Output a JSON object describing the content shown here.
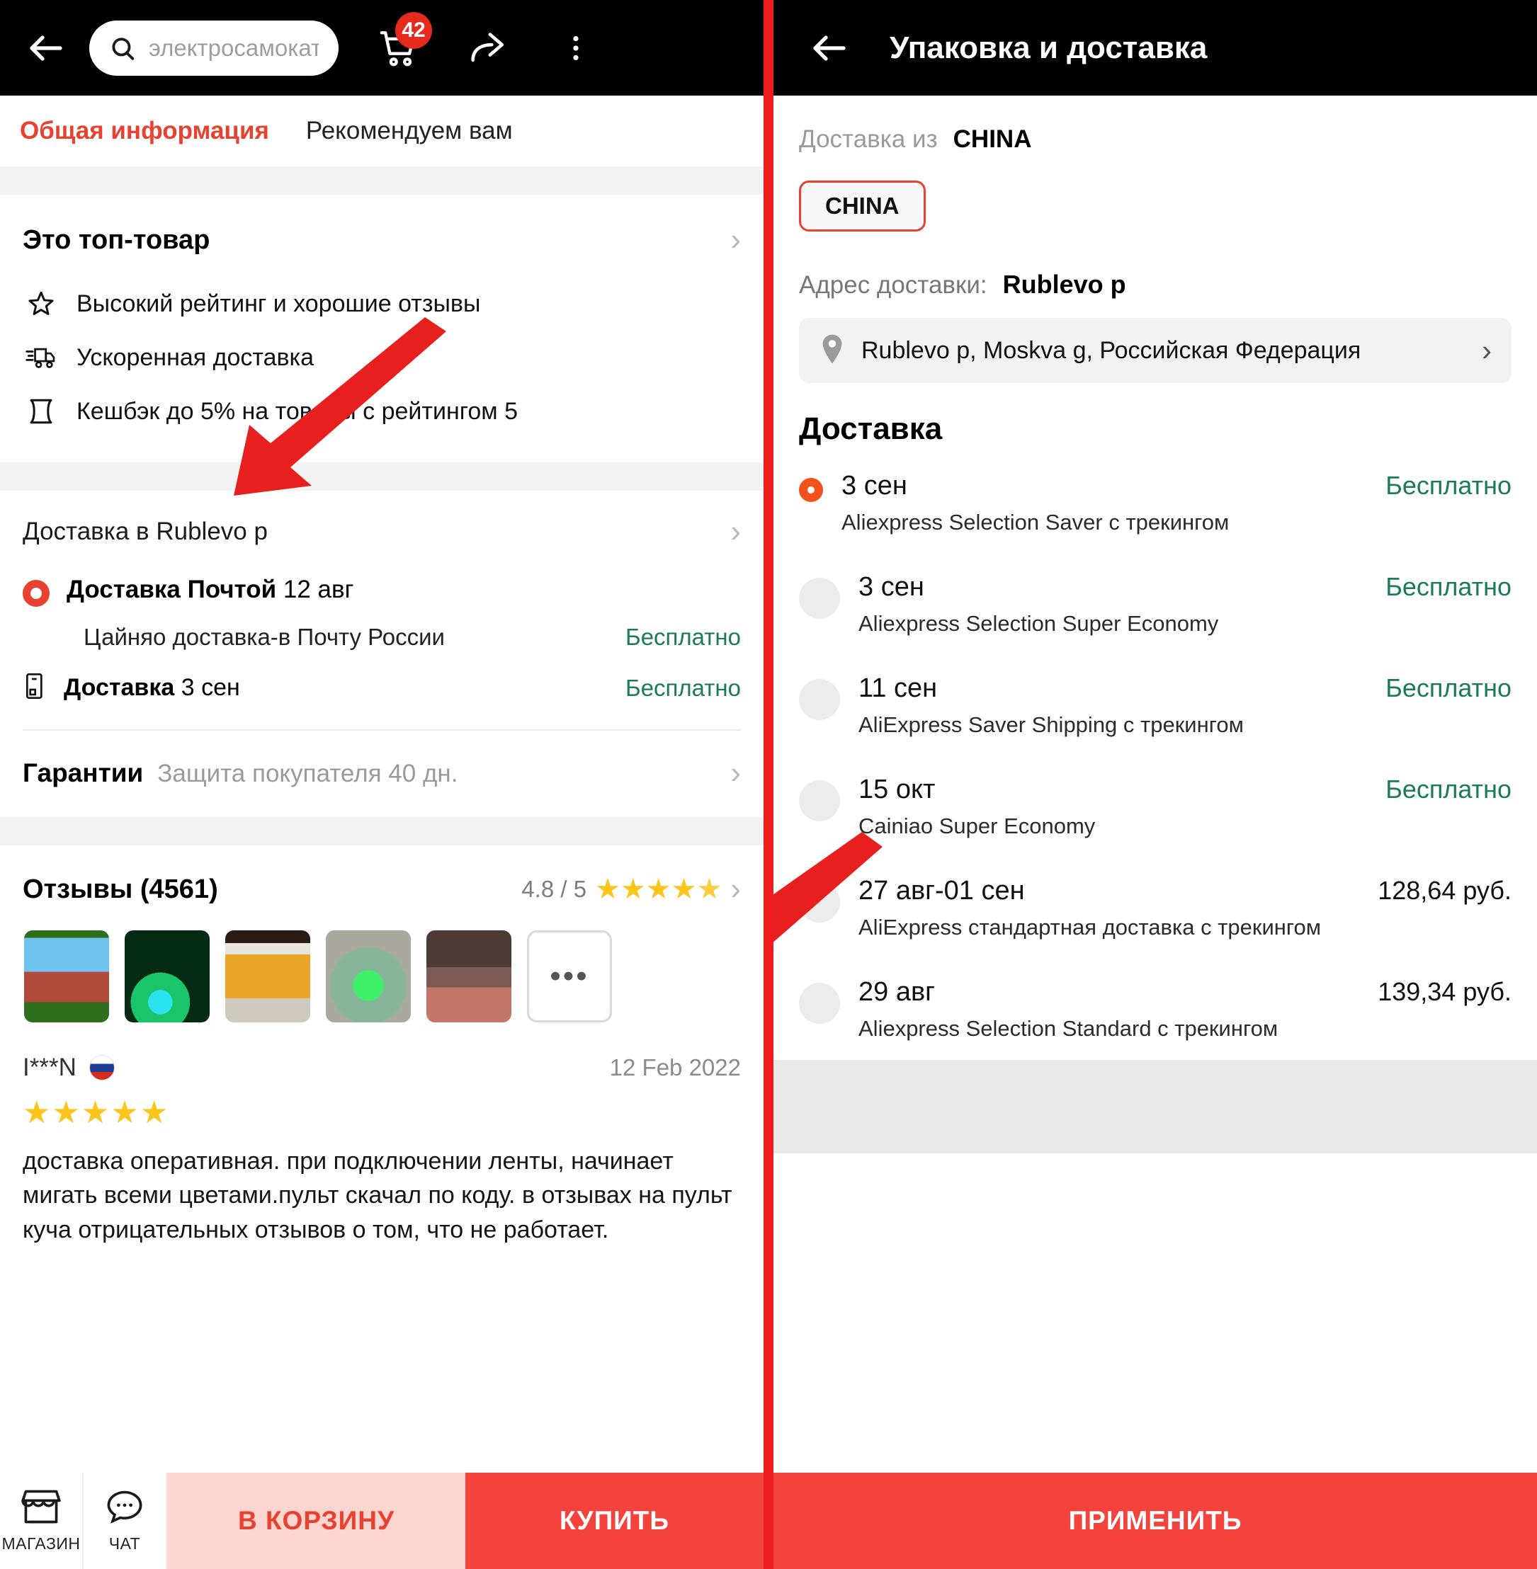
{
  "left": {
    "topbar": {
      "back_icon": "back-arrow-icon",
      "search_placeholder": "электросамокат вз...",
      "search_icon": "search-icon",
      "cart_icon": "cart-icon",
      "cart_badge": "42",
      "share_icon": "share-icon",
      "more_icon": "more-vertical-icon"
    },
    "tabs": [
      {
        "label": "Общая информация",
        "active": true
      },
      {
        "label": "Рекомендуем вам",
        "active": false
      }
    ],
    "top_product": {
      "title": "Это топ-товар",
      "features": [
        {
          "icon": "star-outline-icon",
          "label": "Высокий рейтинг и хорошие отзывы"
        },
        {
          "icon": "fast-truck-icon",
          "label": "Ускоренная доставка"
        },
        {
          "icon": "cashback-icon",
          "label": "Кешбэк до 5% на товары с рейтингом 5"
        }
      ]
    },
    "delivery": {
      "header": "Доставка в Rublevo p",
      "selected_option": "Доставка Почтой",
      "selected_date": "12 авг",
      "carrier_line": "Цайняо доставка-в Почту России",
      "carrier_price": "Бесплатно",
      "shipping_label": "Доставка",
      "shipping_date": "3 сен",
      "shipping_price": "Бесплатно"
    },
    "guarantees": {
      "title": "Гарантии",
      "subtitle": "Защита покупателя 40 дн."
    },
    "reviews": {
      "title": "Отзывы (4561)",
      "rating": "4.8 / 5",
      "stars_filled": 4,
      "stars_half": 1,
      "thumbnails": [
        "thumb-1",
        "thumb-2",
        "thumb-3",
        "thumb-4",
        "thumb-5"
      ],
      "more_label": "•••",
      "review": {
        "author": "I***N",
        "country_flag": "russia-flag-icon",
        "date": "12 Feb 2022",
        "stars": 5,
        "text": "доставка оперативная. при подключении ленты, начинает мигать всеми цветами.пульт скачал по коду. в отзывах на пульт куча отрицательных отзывов о том, что не работает."
      }
    },
    "bottombar": {
      "shop_icon": "shop-icon",
      "shop_label": "МАГАЗИН",
      "chat_icon": "chat-icon",
      "chat_label": "ЧАТ",
      "cart_label": "В КОРЗИНУ",
      "buy_label": "КУПИТЬ"
    }
  },
  "right": {
    "topbar": {
      "back_icon": "back-arrow-icon",
      "title": "Упаковка и доставка"
    },
    "ship_from": {
      "label": "Доставка из",
      "value": "CHINA",
      "chip": "CHINA"
    },
    "address": {
      "label": "Адрес доставки:",
      "value": "Rublevo p",
      "pin_icon": "location-pin-icon",
      "full": "Rublevo p, Moskva g, Российская Федерация",
      "chev_icon": "chevron-right-icon"
    },
    "delivery_title": "Доставка",
    "options": [
      {
        "date": "3 сен",
        "name": "Aliexpress Selection Saver с трекингом",
        "price": "Бесплатно",
        "free": true,
        "selected": true
      },
      {
        "date": "3 сен",
        "name": "Aliexpress Selection Super Economy",
        "price": "Бесплатно",
        "free": true,
        "selected": false
      },
      {
        "date": "11 сен",
        "name": "AliExpress Saver Shipping с трекингом",
        "price": "Бесплатно",
        "free": true,
        "selected": false
      },
      {
        "date": "15 окт",
        "name": "Cainiao Super Economy",
        "price": "Бесплатно",
        "free": true,
        "selected": false
      },
      {
        "date": "27 авг-01 сен",
        "name": "AliExpress стандартная доставка с трекингом",
        "price": "128,64 руб.",
        "free": false,
        "selected": false
      },
      {
        "date": "29 авг",
        "name": "Aliexpress Selection Standard с трекингом",
        "price": "139,34 руб.",
        "free": false,
        "selected": false
      }
    ],
    "apply_label": "ПРИМЕНИТЬ"
  },
  "colors": {
    "accent_red": "#e8412f",
    "buy_red": "#f4433c",
    "divider_red": "#ee1d1d",
    "free_green": "#1b7a5a",
    "annotation_red": "#e81f1f",
    "star_yellow": "#fbc51c"
  }
}
